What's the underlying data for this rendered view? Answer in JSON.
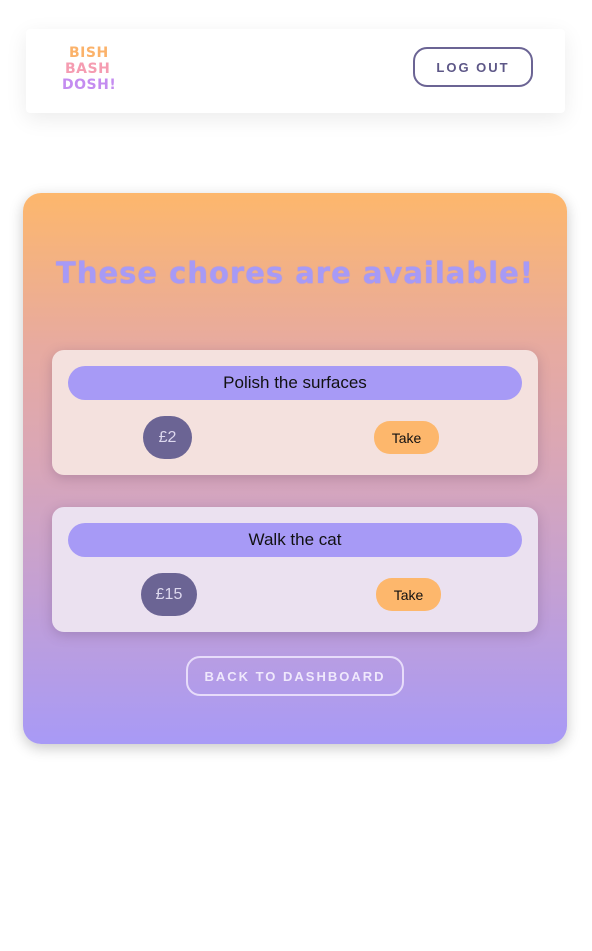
{
  "header": {
    "logo_lines": [
      "BISH",
      "BASH",
      "DOSH!"
    ],
    "logout_label": "LOG OUT"
  },
  "panel": {
    "title": "These chores are available!",
    "chores": [
      {
        "name": "Polish the surfaces",
        "price": "£2",
        "action_label": "Take"
      },
      {
        "name": "Walk the cat",
        "price": "£15",
        "action_label": "Take"
      }
    ],
    "back_label": "BACK TO DASHBOARD"
  },
  "colors": {
    "accent_purple": "#a79af6",
    "accent_orange": "#fdb76c",
    "dark_purple": "#6b6494",
    "logo_orange": "#fbb26a",
    "logo_pink": "#f59cb1",
    "logo_violet": "#c48cf0"
  }
}
